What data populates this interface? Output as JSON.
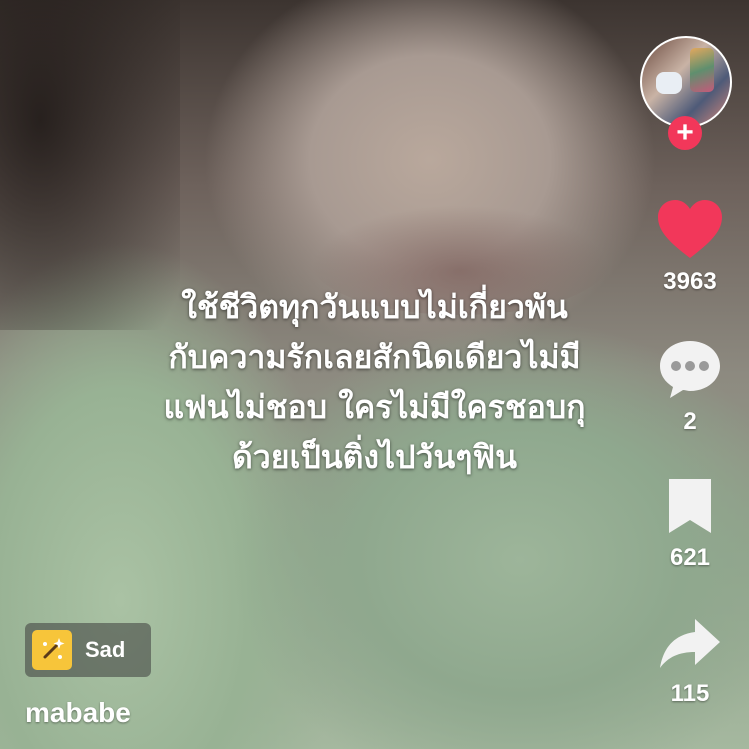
{
  "caption": {
    "lines": [
      "ใช้ชีวิตทุกวันแบบไม่เกี่ยวพัน",
      "กับความรักเลยสักนิดเดียวไม่มี",
      "แฟนไม่ชอบ ใครไม่มีใครชอบกุ",
      "ด้วยเป็นติ่งไปวันๆฟิน"
    ]
  },
  "rail": {
    "follow_label": "+",
    "likes": "3963",
    "comments": "2",
    "saves": "621",
    "shares": "115",
    "like_color": "#f2375a"
  },
  "sticker": {
    "label": "Sad",
    "icon": "sparkle-icon",
    "icon_color": "#f7c53a"
  },
  "author": {
    "username": "mababe"
  }
}
